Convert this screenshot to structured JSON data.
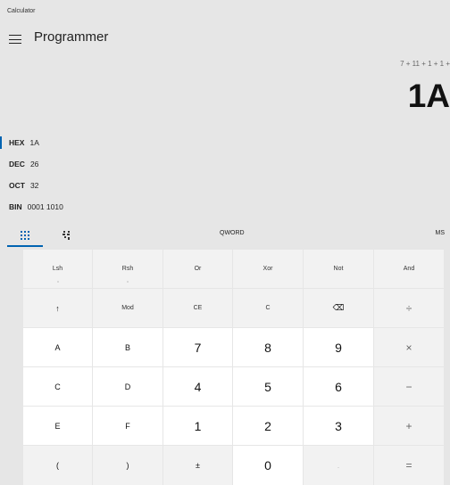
{
  "app": {
    "title": "Calculator",
    "mode": "Programmer"
  },
  "display": {
    "expression": "7 + 11 + 1 + 1 + ",
    "result": "1A"
  },
  "radix": [
    {
      "label": "HEX",
      "value": "1A",
      "active": true
    },
    {
      "label": "DEC",
      "value": "26",
      "active": false
    },
    {
      "label": "OCT",
      "value": "32",
      "active": false
    },
    {
      "label": "BIN",
      "value": "0001 1010",
      "active": false
    }
  ],
  "toolbar": {
    "word_size": "QWORD",
    "memory": "MS"
  },
  "colors": {
    "accent": "#0063b1",
    "background": "#e6e6e6"
  },
  "keys": {
    "lsh": "Lsh",
    "rsh": "Rsh",
    "or": "Or",
    "xor": "Xor",
    "not": "Not",
    "and": "And",
    "shift": "↑",
    "mod": "Mod",
    "ce": "CE",
    "c": "C",
    "backspace": "⌫",
    "divide": "÷",
    "a": "A",
    "b": "B",
    "seven": "7",
    "eight": "8",
    "nine": "9",
    "multiply": "×",
    "c_hex": "C",
    "d": "D",
    "four": "4",
    "five": "5",
    "six": "6",
    "minus": "−",
    "e": "E",
    "f": "F",
    "one": "1",
    "two": "2",
    "three": "3",
    "plus": "+",
    "lparen": "(",
    "rparen": ")",
    "negate": "±",
    "zero": "0",
    "decimal": ".",
    "equals": "="
  }
}
